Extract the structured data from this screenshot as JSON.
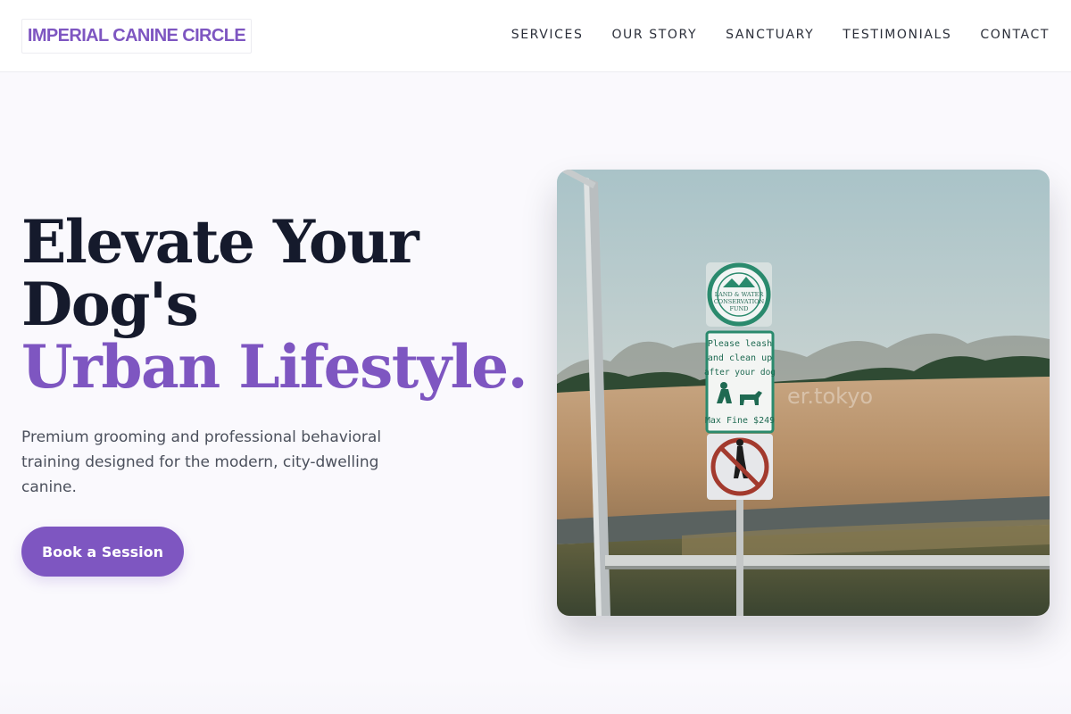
{
  "brand": {
    "name": "IMPERIAL CANINE CIRCLE",
    "accent_color": "#7e56c1"
  },
  "nav": {
    "items": [
      {
        "label": "SERVICES"
      },
      {
        "label": "OUR STORY"
      },
      {
        "label": "SANCTUARY"
      },
      {
        "label": "TESTIMONIALS"
      },
      {
        "label": "CONTACT"
      }
    ]
  },
  "hero": {
    "title_line1": "Elevate Your",
    "title_line2": "Dog's",
    "title_accent": "Urban Lifestyle.",
    "description": "Premium grooming and professional behavioral training designed for the modern, city-dwelling canine.",
    "cta_label": "Book a Session"
  },
  "photo": {
    "subject": "park signs on a pole in a field",
    "sign_top": {
      "lines": [
        "LAND & WATER",
        "CONSERVATION",
        "FUND"
      ]
    },
    "sign_middle": {
      "lines": [
        "Please leash",
        "and clean up",
        "after your dog",
        "Max Fine $249"
      ]
    },
    "sign_bottom_icon": "no-golf-icon",
    "watermark": "er.tokyo"
  }
}
